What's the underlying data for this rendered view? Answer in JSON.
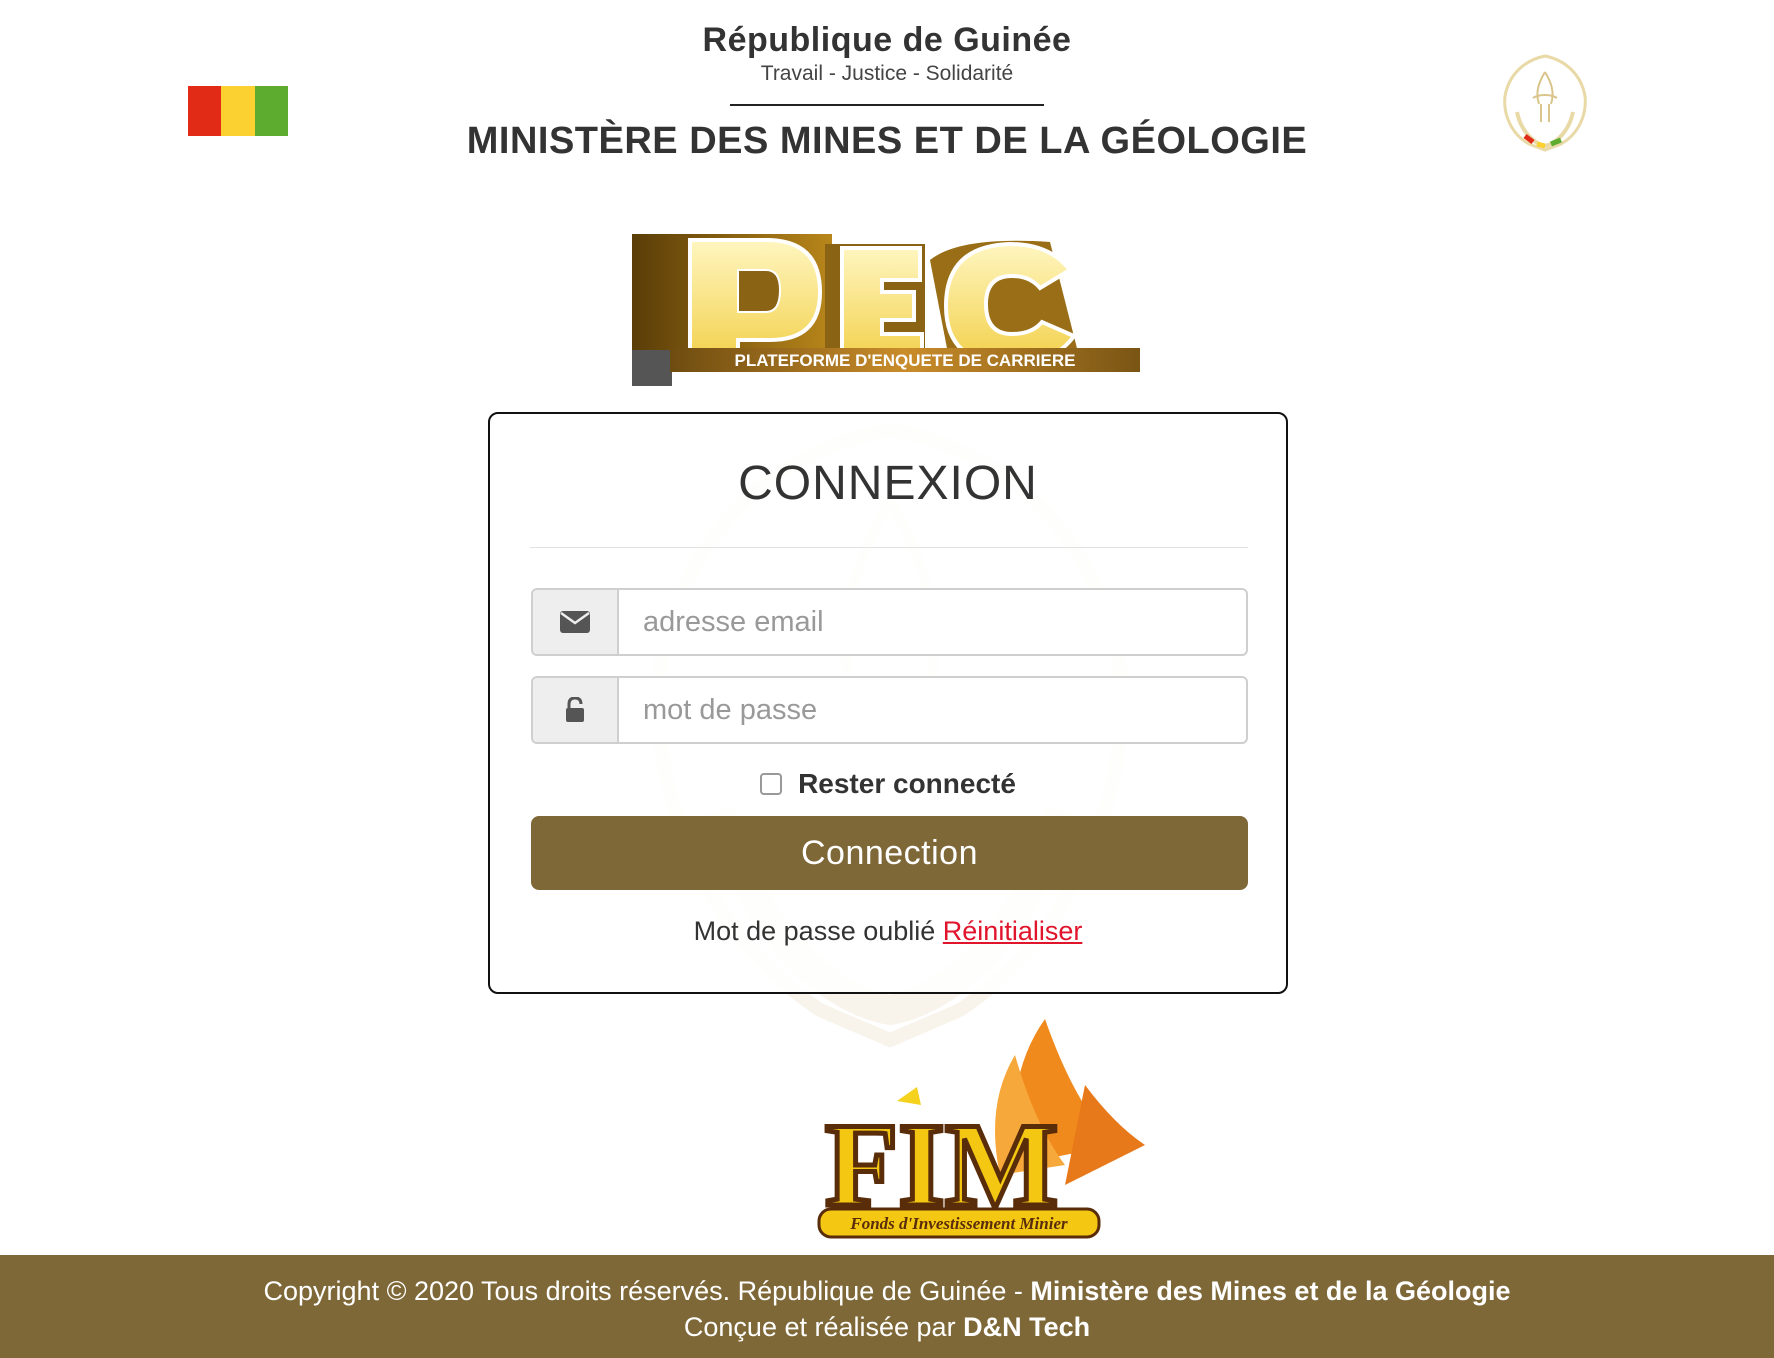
{
  "header": {
    "country": "République de Guinée",
    "motto": "Travail - Justice - Solidarité",
    "ministry": "MINISTÈRE DES MINES ET DE LA GÉOLOGIE"
  },
  "flag_colors": [
    "#e12b16",
    "#fbd031",
    "#5dac30"
  ],
  "pec_logo": {
    "letters": "PEC",
    "tagline": "PLATEFORME D'ENQUETE DE CARRIERE"
  },
  "login": {
    "title": "CONNEXION",
    "email_placeholder": "adresse email",
    "email_icon": "envelope-icon",
    "password_placeholder": "mot de passe",
    "password_icon": "unlock-icon",
    "remember_label": "Rester connecté",
    "submit_label": "Connection",
    "forgot_text": "Mot de passe oublié",
    "reset_link": "Réinitialiser"
  },
  "fim_logo": {
    "letters": "FIM",
    "tagline": "Fonds d'Investissement Minier"
  },
  "footer": {
    "line1_text": "Copyright © 2020 Tous droits réservés. République de Guinée - ",
    "line1_bold": "Ministère des Mines et de la Géologie",
    "line2_text": "Conçue et réalisée par ",
    "line2_bold": "D&N Tech"
  },
  "colors": {
    "brand_brown": "#7e6838",
    "link_red": "#e0142b"
  }
}
